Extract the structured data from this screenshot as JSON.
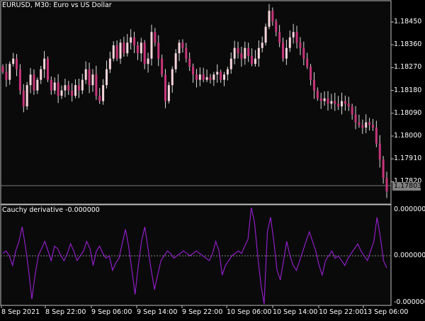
{
  "chart": {
    "title": "EURUSD, M30:  Euro vs US Dollar",
    "current_price": "1.17803",
    "colors": {
      "background": "#0a0a0a",
      "frame": "#bfbfbf",
      "bull_body": "#f6d5dc",
      "bear_body": "#c7357a",
      "wick": "#dcdcdc",
      "indicator_line": "#9b1fd6",
      "zero_line": "#8a8a8a",
      "current_price_line": "#7a7a7a",
      "current_price_badge": "#808080"
    },
    "price_axis": [
      "1.18450",
      "1.18360",
      "1.18270",
      "1.18180",
      "1.18090",
      "1.18000",
      "1.17910",
      "1.17820"
    ],
    "time_axis": [
      "8 Sep 2021",
      "8 Sep 22:00",
      "9 Sep 06:00",
      "9 Sep 14:00",
      "9 Sep 22:00",
      "10 Sep 06:00",
      "10 Sep 14:00",
      "10 Sep 22:00",
      "13 Sep 06:00"
    ]
  },
  "indicator": {
    "title": "Cauchy derivative -0.000000",
    "axis": [
      "0.000000",
      "0.000000",
      "-0.000000"
    ]
  },
  "chart_data": {
    "type": "candlestick",
    "price_range": [
      1.1776,
      1.1851
    ],
    "price_path": [
      1.1825,
      1.1822,
      1.1828,
      1.183,
      1.1826,
      1.1818,
      1.1812,
      1.182,
      1.1824,
      1.1818,
      1.1822,
      1.1826,
      1.183,
      1.1822,
      1.1818,
      1.1821,
      1.1816,
      1.1818,
      1.182,
      1.1818,
      1.1816,
      1.182,
      1.1818,
      1.1822,
      1.1826,
      1.182,
      1.1824,
      1.1816,
      1.1814,
      1.182,
      1.1826,
      1.183,
      1.1835,
      1.183,
      1.1836,
      1.1832,
      1.1836,
      1.1838,
      1.1835,
      1.1832,
      1.1836,
      1.1828,
      1.183,
      1.184,
      1.1836,
      1.183,
      1.1824,
      1.1814,
      1.182,
      1.1826,
      1.1832,
      1.1836,
      1.1834,
      1.183,
      1.1827,
      1.1824,
      1.1822,
      1.1824,
      1.1822,
      1.1823,
      1.1822,
      1.1824,
      1.1825,
      1.1822,
      1.1824,
      1.1826,
      1.183,
      1.1834,
      1.1832,
      1.183,
      1.1834,
      1.1831,
      1.1828,
      1.183,
      1.1834,
      1.1836,
      1.1842,
      1.1848,
      1.1844,
      1.184,
      1.1836,
      1.183,
      1.1834,
      1.1838,
      1.184,
      1.1836,
      1.1834,
      1.183,
      1.1827,
      1.1822,
      1.1818,
      1.1815,
      1.1814,
      1.1815,
      1.1813,
      1.1814,
      1.1813,
      1.1812,
      1.1814,
      1.1813,
      1.1812,
      1.1809,
      1.1806,
      1.1805,
      1.1804,
      1.1806,
      1.1805,
      1.1804,
      1.1798,
      1.1792,
      1.1785,
      1.178
    ],
    "indicator_path": [
      0.05,
      0.1,
      0.0,
      -0.2,
      0.1,
      0.3,
      0.6,
      0.2,
      -0.3,
      -0.9,
      -0.4,
      0.0,
      0.15,
      0.3,
      0.1,
      -0.1,
      0.2,
      0.15,
      0.0,
      -0.1,
      0.05,
      0.25,
      0.1,
      -0.1,
      0.0,
      0.1,
      0.3,
      0.15,
      -0.2,
      0.1,
      0.2,
      0.05,
      -0.05,
      0.0,
      -0.3,
      -0.15,
      -0.05,
      0.25,
      0.55,
      0.2,
      -0.3,
      -0.8,
      -0.2,
      0.3,
      0.6,
      0.15,
      -0.3,
      -0.7,
      -0.4,
      -0.1,
      0.0,
      0.1,
      0.05,
      -0.05,
      0.0,
      0.05,
      0.1,
      0.05,
      0.0,
      0.05,
      0.1,
      0.05,
      0.0,
      -0.05,
      -0.1,
      0.05,
      0.3,
      0.1,
      -0.4,
      -0.2,
      -0.1,
      0.0,
      0.05,
      0.1,
      0.05,
      0.2,
      0.35,
      1.0,
      0.7,
      0.0,
      -0.6,
      -1.0,
      0.5,
      0.8,
      0.3,
      -0.3,
      -0.5,
      -0.1,
      0.3,
      0.0,
      -0.2,
      -0.3,
      -0.1,
      0.1,
      0.3,
      0.5,
      0.3,
      0.1,
      -0.2,
      -0.4,
      -0.1,
      0.0,
      0.1,
      -0.05,
      0.0,
      -0.1,
      -0.2,
      -0.05,
      0.05,
      0.15,
      0.25,
      0.1,
      0.0,
      -0.1,
      0.1,
      0.3,
      0.8,
      0.4,
      -0.1,
      -0.25
    ]
  }
}
